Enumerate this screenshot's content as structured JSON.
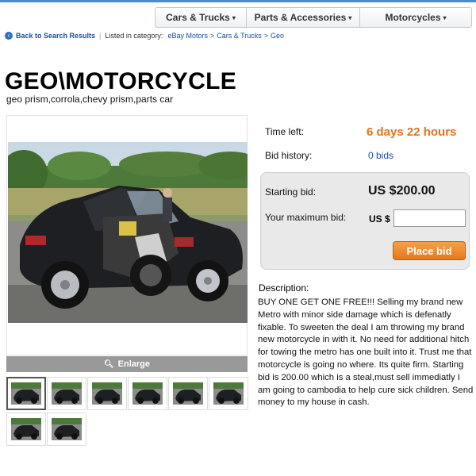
{
  "nav": {
    "items": [
      {
        "label": "Cars & Trucks",
        "caret": "▾"
      },
      {
        "label": "Parts & Accessories",
        "caret": "▾"
      },
      {
        "label": "Motorcycles",
        "caret": "▾"
      }
    ]
  },
  "breadcrumb": {
    "back_label": "Back to Search Results",
    "listed_label": "Listed in category:",
    "path": [
      "eBay Motors",
      "Cars & Trucks",
      "Geo"
    ]
  },
  "item": {
    "title": "GEO\\MOTORCYCLE",
    "subtitle": "geo prism,corrola,chevy prism,parts car"
  },
  "gallery": {
    "enlarge_label": "Enlarge",
    "thumbnail_count": 8,
    "selected_index": 0
  },
  "listing": {
    "time_left_label": "Time left:",
    "time_left_value": "6 days 22 hours",
    "bid_history_label": "Bid history:",
    "bid_history_value": "0 bids",
    "starting_bid_label": "Starting bid:",
    "starting_bid_value": "US $200.00",
    "max_bid_label": "Your maximum bid:",
    "max_bid_prefix": "US $",
    "max_bid_value": "",
    "place_bid_label": "Place bid"
  },
  "description": {
    "label": "Description:",
    "text": "BUY ONE GET ONE FREE!!! Selling my brand new Metro with minor side damage which is defenatly fixable. To sweeten the deal I am throwing my brand new motorcycle in with it. No need for additional hitch for towing the metro has one built into it. Trust me that motorcycle is going no where. Its quite firm.  Starting bid is 200.00 which is a steal,must sell immediatly I am going to cambodia to help cure sick children. Send money to my house in cash."
  },
  "colors": {
    "accent_orange": "#e8711a",
    "link_blue": "#1a4ea3",
    "top_border_blue": "#4c8bd0"
  }
}
